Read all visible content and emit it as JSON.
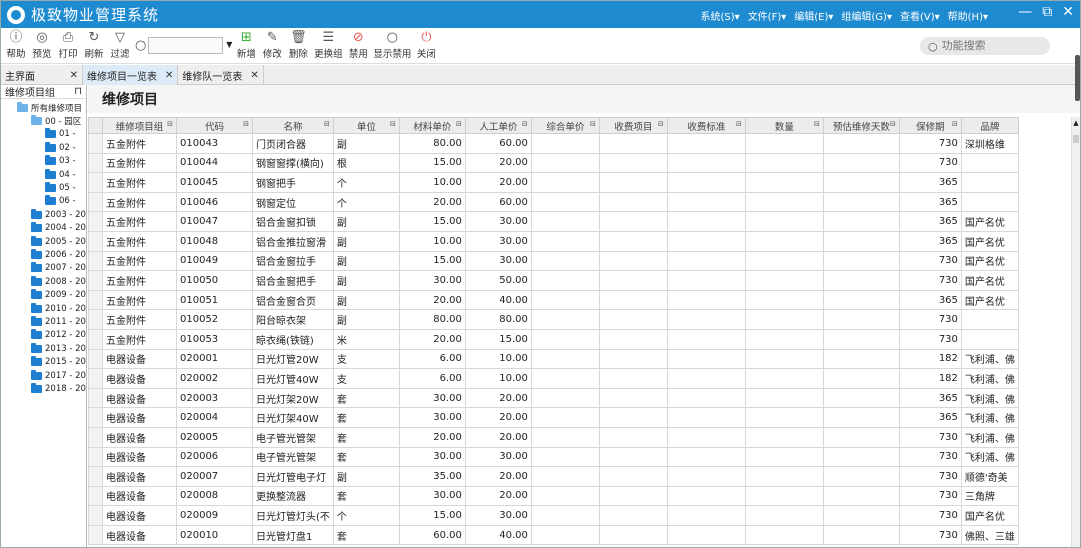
{
  "app": {
    "title": "极致物业管理系统"
  },
  "menus": [
    "系统(S)▾",
    "文件(F)▾",
    "编辑(E)▾",
    "组编辑(G)▾",
    "查看(V)▾",
    "帮助(H)▾"
  ],
  "window_controls": {
    "minimize": "—",
    "restore": "⧉",
    "close": "✕"
  },
  "toolbar": {
    "help": "帮助",
    "preview": "预览",
    "print": "打印",
    "refresh": "刷新",
    "filter": "过滤",
    "add": "新增",
    "edit": "修改",
    "delete": "删除",
    "change_group": "更换组",
    "disable": "禁用",
    "show_disabled": "显示禁用",
    "close": "关闭",
    "search_value": "",
    "function_search_placeholder": "功能搜索"
  },
  "tabs": [
    {
      "label": "主界面",
      "close": "✕"
    },
    {
      "label": "维修项目一览表",
      "close": "✕"
    },
    {
      "label": "维修队一览表",
      "close": "✕"
    }
  ],
  "sidebar": {
    "header": "维修项目组",
    "pin": "⊓",
    "root": "所有维修项目",
    "nodes": [
      "00 - 园区",
      "01 -",
      "02 -",
      "03 -",
      "04 -",
      "05 -",
      "06 -",
      "2003 - 20",
      "2004 - 20",
      "2005 - 20",
      "2006 - 20",
      "2007 - 20",
      "2008 - 20",
      "2009 - 20",
      "2010 - 20",
      "2011 - 20",
      "2012 - 20",
      "2013 - 20",
      "2015 - 20",
      "2017 - 20",
      "2018 - 20"
    ]
  },
  "main": {
    "title": "维修项目",
    "columns": [
      "维修项目组",
      "代码",
      "名称",
      "单位",
      "材料单价",
      "人工单价",
      "综合单价",
      "收费项目",
      "收费标准",
      "数量",
      "预估维修天数",
      "保修期",
      "品牌"
    ],
    "rows": [
      [
        "五金附件",
        "010043",
        "门页闭合器",
        "副",
        "80.00",
        "60.00",
        "",
        "",
        "",
        "",
        "",
        "730",
        "深圳格维"
      ],
      [
        "五金附件",
        "010044",
        "钢窗窗撑(横向)",
        "根",
        "15.00",
        "20.00",
        "",
        "",
        "",
        "",
        "",
        "730",
        ""
      ],
      [
        "五金附件",
        "010045",
        "钢窗把手",
        "个",
        "10.00",
        "20.00",
        "",
        "",
        "",
        "",
        "",
        "365",
        ""
      ],
      [
        "五金附件",
        "010046",
        "钢窗定位",
        "个",
        "20.00",
        "60.00",
        "",
        "",
        "",
        "",
        "",
        "365",
        ""
      ],
      [
        "五金附件",
        "010047",
        "铝合金窗扣锁",
        "副",
        "15.00",
        "30.00",
        "",
        "",
        "",
        "",
        "",
        "365",
        "国产名优"
      ],
      [
        "五金附件",
        "010048",
        "铝合金推拉窗滑",
        "副",
        "10.00",
        "30.00",
        "",
        "",
        "",
        "",
        "",
        "365",
        "国产名优"
      ],
      [
        "五金附件",
        "010049",
        "铝合金窗拉手",
        "副",
        "15.00",
        "30.00",
        "",
        "",
        "",
        "",
        "",
        "730",
        "国产名优"
      ],
      [
        "五金附件",
        "010050",
        "铝合金窗把手",
        "副",
        "30.00",
        "50.00",
        "",
        "",
        "",
        "",
        "",
        "730",
        "国产名优"
      ],
      [
        "五金附件",
        "010051",
        "铝合金窗合页",
        "副",
        "20.00",
        "40.00",
        "",
        "",
        "",
        "",
        "",
        "365",
        "国产名优"
      ],
      [
        "五金附件",
        "010052",
        "阳台晾衣架",
        "副",
        "80.00",
        "80.00",
        "",
        "",
        "",
        "",
        "",
        "730",
        ""
      ],
      [
        "五金附件",
        "010053",
        "晾衣绳(铁链)",
        "米",
        "20.00",
        "15.00",
        "",
        "",
        "",
        "",
        "",
        "730",
        ""
      ],
      [
        "电器设备",
        "020001",
        "日光灯管20W",
        "支",
        "6.00",
        "10.00",
        "",
        "",
        "",
        "",
        "",
        "182",
        "飞利浦、佛"
      ],
      [
        "电器设备",
        "020002",
        "日光灯管40W",
        "支",
        "6.00",
        "10.00",
        "",
        "",
        "",
        "",
        "",
        "182",
        "飞利浦、佛"
      ],
      [
        "电器设备",
        "020003",
        "日光灯架20W",
        "套",
        "30.00",
        "20.00",
        "",
        "",
        "",
        "",
        "",
        "365",
        "飞利浦、佛"
      ],
      [
        "电器设备",
        "020004",
        "日光灯架40W",
        "套",
        "30.00",
        "20.00",
        "",
        "",
        "",
        "",
        "",
        "365",
        "飞利浦、佛"
      ],
      [
        "电器设备",
        "020005",
        "电子管光管架",
        "套",
        "20.00",
        "20.00",
        "",
        "",
        "",
        "",
        "",
        "730",
        "飞利浦、佛"
      ],
      [
        "电器设备",
        "020006",
        "电子管光管架",
        "套",
        "30.00",
        "30.00",
        "",
        "",
        "",
        "",
        "",
        "730",
        "飞利浦、佛"
      ],
      [
        "电器设备",
        "020007",
        "日光灯管电子灯",
        "副",
        "35.00",
        "20.00",
        "",
        "",
        "",
        "",
        "",
        "730",
        "顺德'奇美"
      ],
      [
        "电器设备",
        "020008",
        "更换整流器",
        "套",
        "30.00",
        "20.00",
        "",
        "",
        "",
        "",
        "",
        "730",
        "三角牌"
      ],
      [
        "电器设备",
        "020009",
        "日光灯管灯头(不",
        "个",
        "15.00",
        "30.00",
        "",
        "",
        "",
        "",
        "",
        "730",
        "国产名优"
      ],
      [
        "电器设备",
        "020010",
        "日光管灯盘1",
        "套",
        "60.00",
        "40.00",
        "",
        "",
        "",
        "",
        "",
        "730",
        "佛照、三雄"
      ]
    ]
  },
  "colors": {
    "titlebar": "#1e8bd1",
    "folder": "#1e7ed0"
  }
}
